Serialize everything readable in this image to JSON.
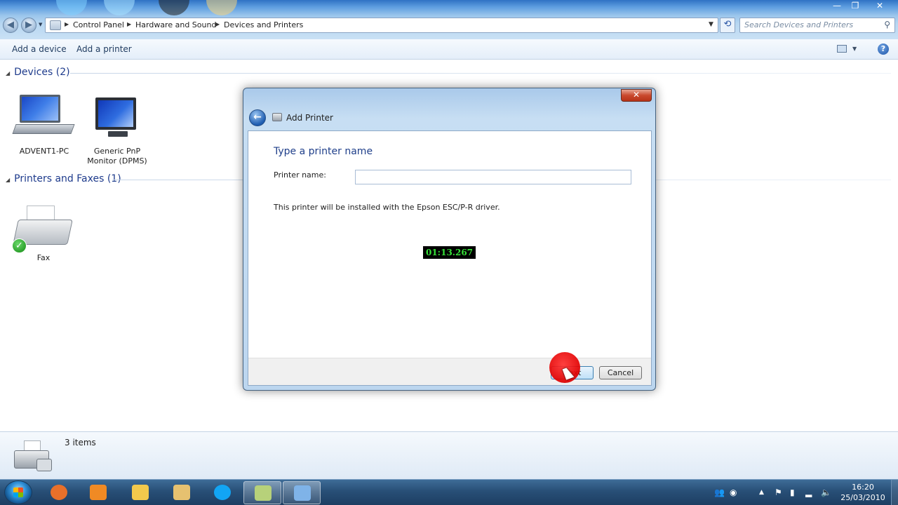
{
  "window": {
    "min": "—",
    "max": "❐",
    "close": "✕",
    "search_placeholder": "Search Devices and Printers"
  },
  "breadcrumb": [
    "Control Panel",
    "Hardware and Sound",
    "Devices and Printers"
  ],
  "command_bar": {
    "add_device": "Add a device",
    "add_printer": "Add a printer",
    "help": "?"
  },
  "groups": {
    "devices": "Devices (2)",
    "printers": "Printers and Faxes (1)"
  },
  "devices": [
    {
      "label": "ADVENT1-PC",
      "icon": "laptop-icon"
    },
    {
      "label": "Generic PnP Monitor (DPMS)",
      "icon": "monitor-icon"
    }
  ],
  "printers": [
    {
      "label": "Fax",
      "icon": "fax-icon"
    }
  ],
  "details": {
    "count": "3 items"
  },
  "dialog": {
    "title": "Add Printer",
    "heading": "Type a printer name",
    "printer_name_label": "Printer name:",
    "printer_name_value": "",
    "driver_note": "This printer will be installed with the Epson ESC/P-R driver.",
    "timer": "01:13.267",
    "next": "Next",
    "cancel": "Cancel",
    "close": "✕"
  },
  "taskbar": {
    "apps": [
      {
        "name": "firefox-icon",
        "color": "#e8702a"
      },
      {
        "name": "media-player-icon",
        "color": "#f08a24"
      },
      {
        "name": "file-explorer-icon",
        "color": "#f2c94c"
      },
      {
        "name": "folder-icon",
        "color": "#e6c170"
      },
      {
        "name": "skype-icon",
        "color": "#12a5f4"
      },
      {
        "name": "notes-icon",
        "color": "#b7d17a"
      },
      {
        "name": "control-panel-icon",
        "color": "#7fb3e8"
      }
    ],
    "clock_time": "16:20",
    "clock_date": "25/03/2010"
  },
  "colors": {
    "accent": "#1f3f8a",
    "timer_text": "#36e038",
    "click_marker": "#e30000"
  }
}
